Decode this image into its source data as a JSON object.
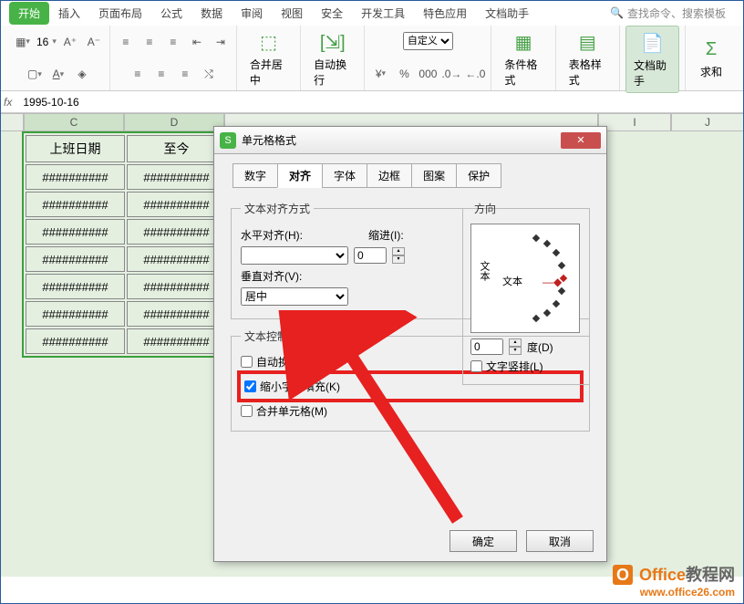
{
  "ribbon": {
    "tabs": [
      "开始",
      "插入",
      "页面布局",
      "公式",
      "数据",
      "审阅",
      "视图",
      "安全",
      "开发工具",
      "特色应用",
      "文档助手"
    ],
    "active_tab": "开始",
    "search_hint": "查找命令、搜索模板",
    "number_format": "自定义",
    "merge_label": "合并居中",
    "wrap_label": "自动换行",
    "cond_format": "条件格式",
    "table_style": "表格样式",
    "doc_helper": "文档助手",
    "sum_label": "求和",
    "font_size": "16"
  },
  "formula_bar": {
    "fx": "fx",
    "value": "1995-10-16"
  },
  "sheet": {
    "columns": [
      "C",
      "D",
      "I",
      "J"
    ],
    "headers": {
      "c": "上班日期",
      "d": "至今"
    },
    "hash": "##########",
    "rows": 7
  },
  "dialog": {
    "title": "单元格格式",
    "tabs": [
      "数字",
      "对齐",
      "字体",
      "边框",
      "图案",
      "保护"
    ],
    "active_tab": "对齐",
    "group_align": "文本对齐方式",
    "h_align_label": "水平对齐(H):",
    "h_align_value": "",
    "indent_label": "缩进(I):",
    "indent_value": "0",
    "v_align_label": "垂直对齐(V):",
    "v_align_value": "居中",
    "group_control": "文本控制",
    "chk_wrap": "自动换行(W)",
    "chk_shrink": "缩小字体填充(K)",
    "chk_merge": "合并单元格(M)",
    "group_dir": "方向",
    "orient_v": "文本",
    "orient_h": "文本",
    "degree_value": "0",
    "degree_label": "度(D)",
    "chk_vertical": "文字竖排(L)",
    "ok": "确定",
    "cancel": "取消"
  },
  "watermark": {
    "brand1": "Office",
    "brand2": "教程网",
    "url": "www.office26.com"
  },
  "chart_data": null
}
